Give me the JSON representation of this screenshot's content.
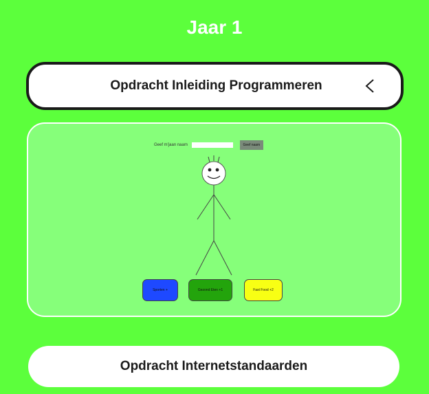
{
  "page": {
    "title": "Jaar 1",
    "background_color": "#5cff3c"
  },
  "assignment_1": {
    "title": "Opdracht Inleiding Programmeren",
    "toggle_icon": "chevron-left-icon",
    "expanded": true,
    "demo": {
      "prompt_label": "Geef m'jaan naam",
      "input_value": "",
      "submit_label": "Geef naam",
      "choices": [
        {
          "label": "Sporten +",
          "color": "#1e49ff"
        },
        {
          "label": "Gezond Eten +1",
          "color": "#23a40c"
        },
        {
          "label": "Fast Food +2",
          "color": "#f8ff14"
        }
      ]
    }
  },
  "assignment_2": {
    "title": "Opdracht Internetstandaarden"
  }
}
